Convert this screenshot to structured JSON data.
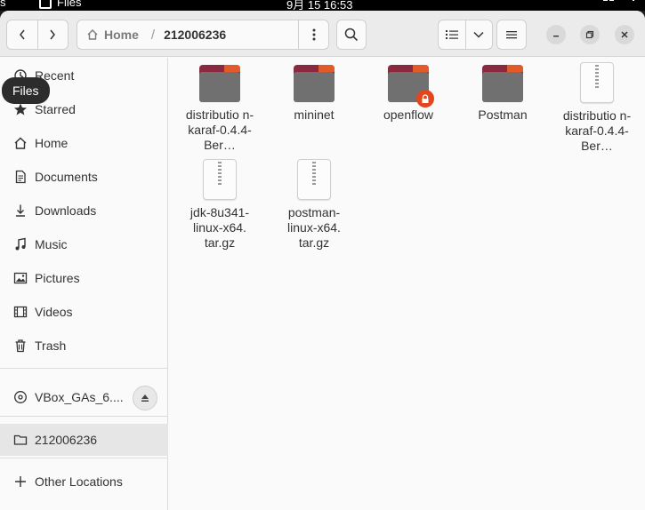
{
  "topbar": {
    "activities": "s",
    "app_name": "Files",
    "clock": "9月 15  16:53"
  },
  "header": {
    "path_home": "Home",
    "path_current": "212006236"
  },
  "tooltip": "Files",
  "sidebar": {
    "items": [
      {
        "label": "Recent",
        "icon": "recent-icon"
      },
      {
        "label": "Starred",
        "icon": "star-icon"
      },
      {
        "label": "Home",
        "icon": "home-icon"
      },
      {
        "label": "Documents",
        "icon": "document-icon"
      },
      {
        "label": "Downloads",
        "icon": "download-icon"
      },
      {
        "label": "Music",
        "icon": "music-icon"
      },
      {
        "label": "Pictures",
        "icon": "picture-icon"
      },
      {
        "label": "Videos",
        "icon": "video-icon"
      },
      {
        "label": "Trash",
        "icon": "trash-icon"
      }
    ],
    "device": "VBox_GAs_6....",
    "bookmark": "212006236",
    "other": "Other Locations"
  },
  "files": [
    {
      "name": "distributio n-karaf-0.4.4-Ber…",
      "kind": "folder"
    },
    {
      "name": "mininet",
      "kind": "folder"
    },
    {
      "name": "openflow",
      "kind": "folder-locked"
    },
    {
      "name": "Postman",
      "kind": "folder"
    },
    {
      "name": "distributio n-karaf-0.4.4-Ber…",
      "kind": "archive"
    },
    {
      "name": "jdk-8u341-linux-x64. tar.gz",
      "kind": "archive"
    },
    {
      "name": "postman-linux-x64. tar.gz",
      "kind": "archive"
    }
  ],
  "colors": {
    "folder_accent": "#e25a2a",
    "folder_tab": "#8a2a40",
    "lock_badge": "#e2461e"
  }
}
